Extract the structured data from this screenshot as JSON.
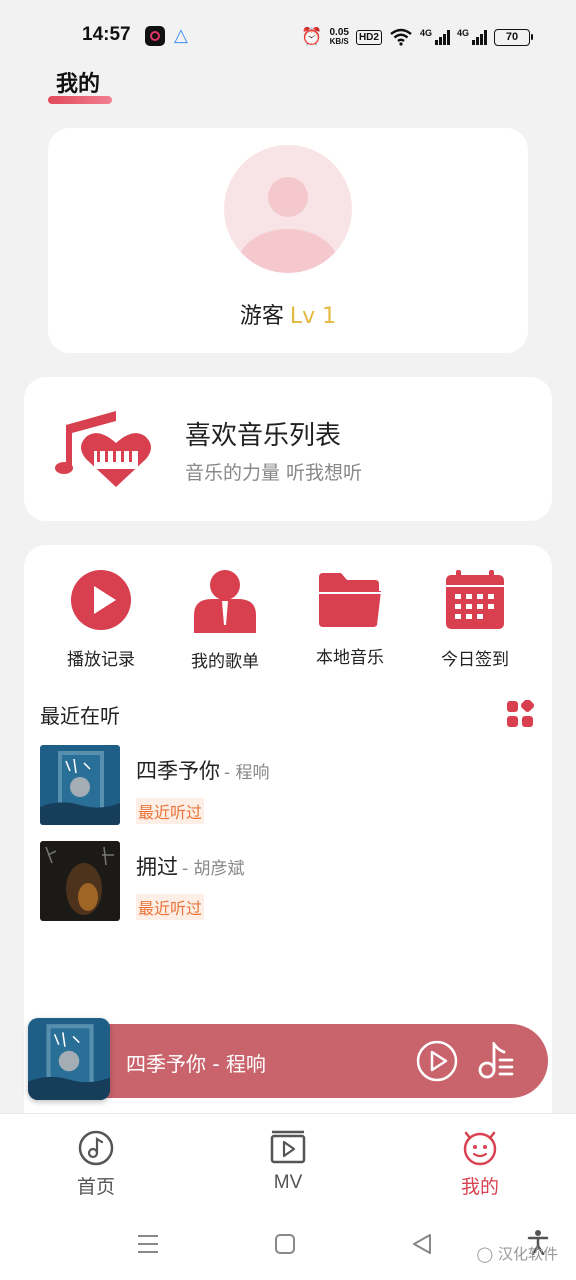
{
  "status_bar": {
    "time": "14:57",
    "speed_value": "0.05",
    "speed_unit": "KB/S",
    "hd_label": "HD2",
    "net1": "4G",
    "net2": "4G",
    "battery": "70"
  },
  "header": {
    "title": "我的"
  },
  "profile": {
    "username": "游客",
    "level": "Lv 1"
  },
  "favorites": {
    "title": "喜欢音乐列表",
    "subtitle": "音乐的力量 听我想听"
  },
  "shortcuts": [
    {
      "label": "播放记录",
      "icon": "play-circle-icon"
    },
    {
      "label": "我的歌单",
      "icon": "user-icon"
    },
    {
      "label": "本地音乐",
      "icon": "folder-icon"
    },
    {
      "label": "今日签到",
      "icon": "calendar-icon"
    }
  ],
  "recent": {
    "title": "最近在听",
    "songs": [
      {
        "title": "四季予你",
        "artist": "- 程响",
        "tag": "最近听过"
      },
      {
        "title": "拥过",
        "artist": "- 胡彦斌",
        "tag": "最近听过"
      }
    ]
  },
  "player": {
    "now_playing": "四季予你 - 程响"
  },
  "nav": {
    "items": [
      {
        "label": "首页",
        "icon": "music-disc-icon"
      },
      {
        "label": "MV",
        "icon": "video-play-icon"
      },
      {
        "label": "我的",
        "icon": "smiley-face-icon"
      }
    ],
    "active": "我的"
  },
  "watermark": "汉化软件",
  "colors": {
    "accent": "#d94251",
    "player_bg": "#c9646c",
    "level": "#e4b93f",
    "tag": "#e9753a"
  }
}
